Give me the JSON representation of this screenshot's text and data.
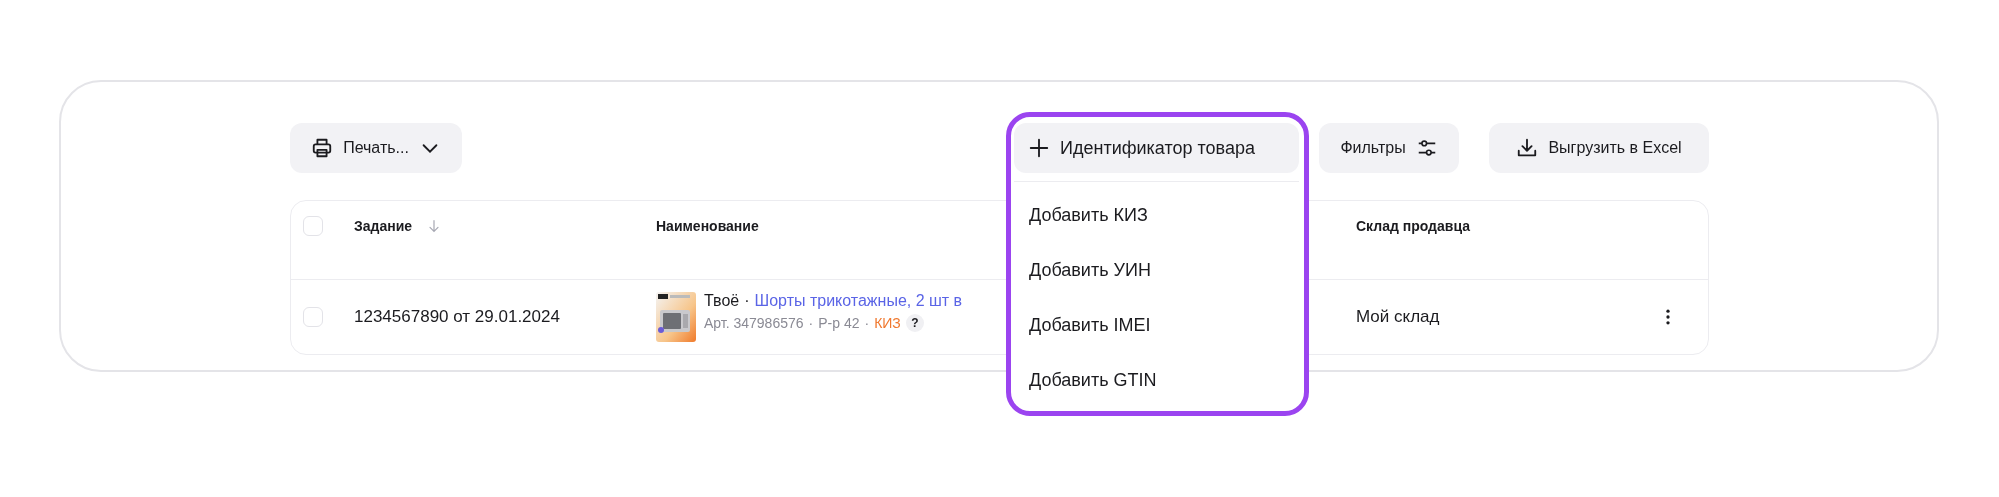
{
  "toolbar": {
    "print_button": "Печать...",
    "identifier_button": "Идентификатор товара",
    "filters_button": "Фильтры",
    "export_button": "Выгрузить в Excel"
  },
  "identifier_menu": {
    "expanded": true,
    "items": [
      "Добавить КИЗ",
      "Добавить УИН",
      "Добавить IMEI",
      "Добавить GTIN"
    ]
  },
  "table": {
    "select_all": {
      "checked": false
    },
    "columns": [
      {
        "label": "Задание",
        "sorted": true
      },
      {
        "label": "Наименование",
        "sorted": false
      },
      {
        "label": "Склад продавца",
        "sorted": false
      }
    ],
    "rows": [
      {
        "checked": false,
        "task": "1234567890 от 29.01.2024",
        "brand": "Твоё",
        "brand_separator": "·",
        "name": "Шорты трикотажные, 2 шт в",
        "meta": [
          {
            "kind": "text",
            "text": "Арт. 347986576"
          },
          {
            "kind": "dot",
            "text": "·"
          },
          {
            "kind": "text",
            "text": "Р-р 42"
          },
          {
            "kind": "dot",
            "text": "·"
          },
          {
            "kind": "tag",
            "text": "КИЗ"
          },
          {
            "kind": "help",
            "text": "?"
          }
        ],
        "warehouse": "Мой склад"
      }
    ]
  }
}
